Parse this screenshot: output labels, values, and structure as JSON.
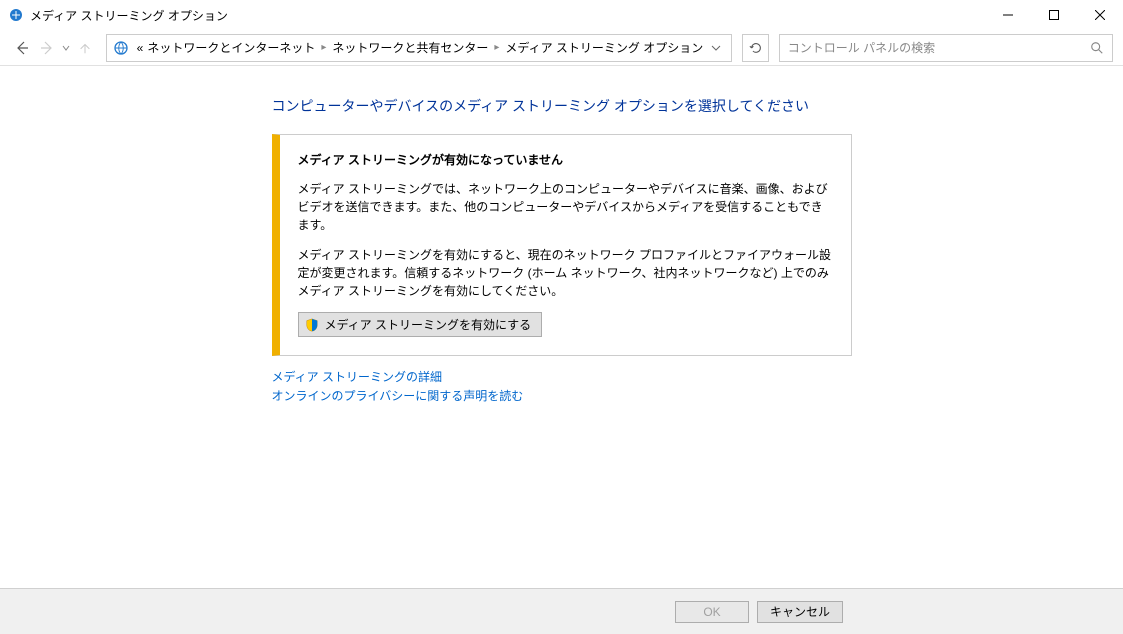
{
  "window": {
    "title": "メディア ストリーミング オプション"
  },
  "breadcrumb": {
    "prefix": "«",
    "items": [
      "ネットワークとインターネット",
      "ネットワークと共有センター",
      "メディア ストリーミング オプション"
    ]
  },
  "search": {
    "placeholder": "コントロール パネルの検索"
  },
  "page": {
    "heading": "コンピューターやデバイスのメディア ストリーミング オプションを選択してください"
  },
  "notice": {
    "title": "メディア ストリーミングが有効になっていません",
    "para1": "メディア ストリーミングでは、ネットワーク上のコンピューターやデバイスに音楽、画像、およびビデオを送信できます。また、他のコンピューターやデバイスからメディアを受信することもできます。",
    "para2": "メディア ストリーミングを有効にすると、現在のネットワーク プロファイルとファイアウォール設定が変更されます。信頼するネットワーク (ホーム ネットワーク、社内ネットワークなど) 上でのみメディア ストリーミングを有効にしてください。",
    "enable_button": "メディア ストリーミングを有効にする"
  },
  "links": {
    "details": "メディア ストリーミングの詳細",
    "privacy": "オンラインのプライバシーに関する声明を読む"
  },
  "footer": {
    "ok": "OK",
    "cancel": "キャンセル"
  }
}
